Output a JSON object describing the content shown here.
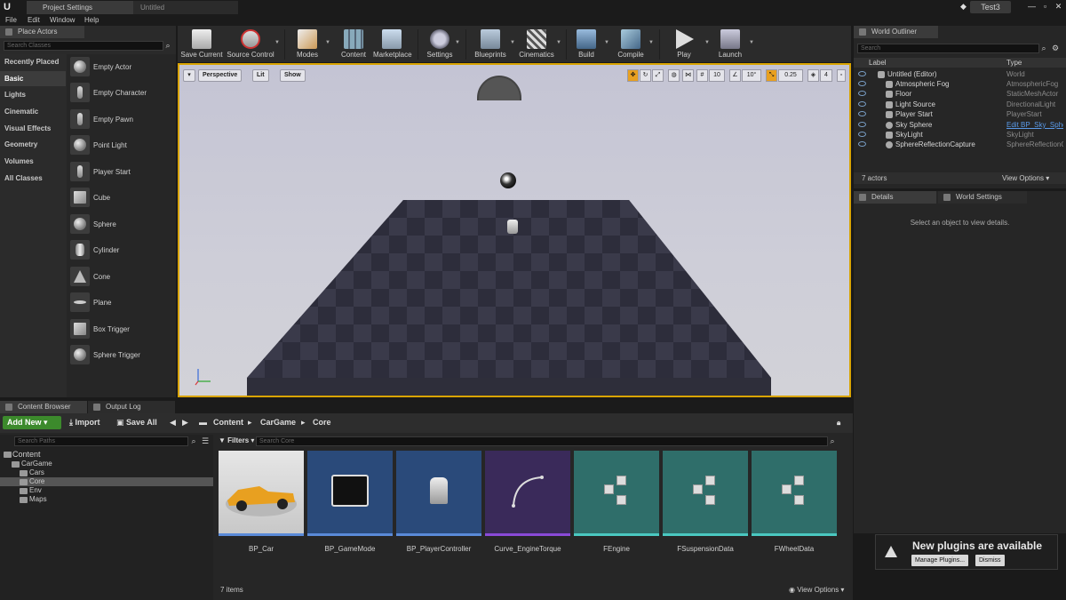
{
  "titlebar": {
    "tabs": [
      "Project Settings",
      "Untitled"
    ],
    "project_name": "Test3"
  },
  "menu": [
    "File",
    "Edit",
    "Window",
    "Help"
  ],
  "place_actors": {
    "tab": "Place Actors",
    "search_placeholder": "Search Classes",
    "categories": [
      "Recently Placed",
      "Basic",
      "Lights",
      "Cinematic",
      "Visual Effects",
      "Geometry",
      "Volumes",
      "All Classes"
    ],
    "actors": [
      "Empty Actor",
      "Empty Character",
      "Empty Pawn",
      "Point Light",
      "Player Start",
      "Cube",
      "Sphere",
      "Cylinder",
      "Cone",
      "Plane",
      "Box Trigger",
      "Sphere Trigger"
    ]
  },
  "toolbar": {
    "items": [
      "Save Current",
      "Source Control",
      "Modes",
      "Content",
      "Marketplace",
      "Settings",
      "Blueprints",
      "Cinematics",
      "Build",
      "Compile",
      "Play",
      "Launch"
    ]
  },
  "viewport": {
    "perspective": "Perspective",
    "lit": "Lit",
    "show": "Show",
    "grid_snap": "10",
    "rotation_snap": "10°",
    "scale_snap": "0.25",
    "camera_speed": "4"
  },
  "outliner": {
    "tab": "World Outliner",
    "search_placeholder": "Search",
    "col_label": "Label",
    "col_type": "Type",
    "rows": [
      {
        "label": "Untitled (Editor)",
        "type": "World"
      },
      {
        "label": "Atmospheric Fog",
        "type": "AtmosphericFog"
      },
      {
        "label": "Floor",
        "type": "StaticMeshActor"
      },
      {
        "label": "Light Source",
        "type": "DirectionalLight"
      },
      {
        "label": "Player Start",
        "type": "PlayerStart"
      },
      {
        "label": "Sky Sphere",
        "type": "Edit BP_Sky_Sphe"
      },
      {
        "label": "SkyLight",
        "type": "SkyLight"
      },
      {
        "label": "SphereReflectionCapture",
        "type": "SphereReflectionC"
      }
    ],
    "count": "7 actors",
    "view_options": "View Options"
  },
  "details": {
    "tabs": [
      "Details",
      "World Settings"
    ],
    "empty": "Select an object to view details."
  },
  "content_browser": {
    "tabs": [
      "Content Browser",
      "Output Log"
    ],
    "add_new": "Add New",
    "import": "Import",
    "save_all": "Save All",
    "breadcrumb": [
      "Content",
      "CarGame",
      "Core"
    ],
    "search_paths": "Search Paths",
    "filters": "Filters",
    "search_core": "Search Core",
    "tree": [
      "Content",
      "CarGame",
      "Cars",
      "Core",
      "Env",
      "Maps"
    ],
    "assets": [
      "BP_Car",
      "BP_GameMode",
      "BP_PlayerController",
      "Curve_EngineTorque",
      "FEngine",
      "FSuspensionData",
      "FWheelData"
    ],
    "count": "7 items",
    "view_options": "View Options"
  },
  "notification": {
    "message": "New plugins are available",
    "manage": "Manage Plugins...",
    "dismiss": "Dismiss"
  },
  "colors": {
    "accent_orange": "#d9a400",
    "add_new_green": "#3c8a2c",
    "blueprint_blue": "#2a4a7a",
    "curve_purple": "#3a2a5a",
    "struct_teal": "#2f6e6a"
  }
}
